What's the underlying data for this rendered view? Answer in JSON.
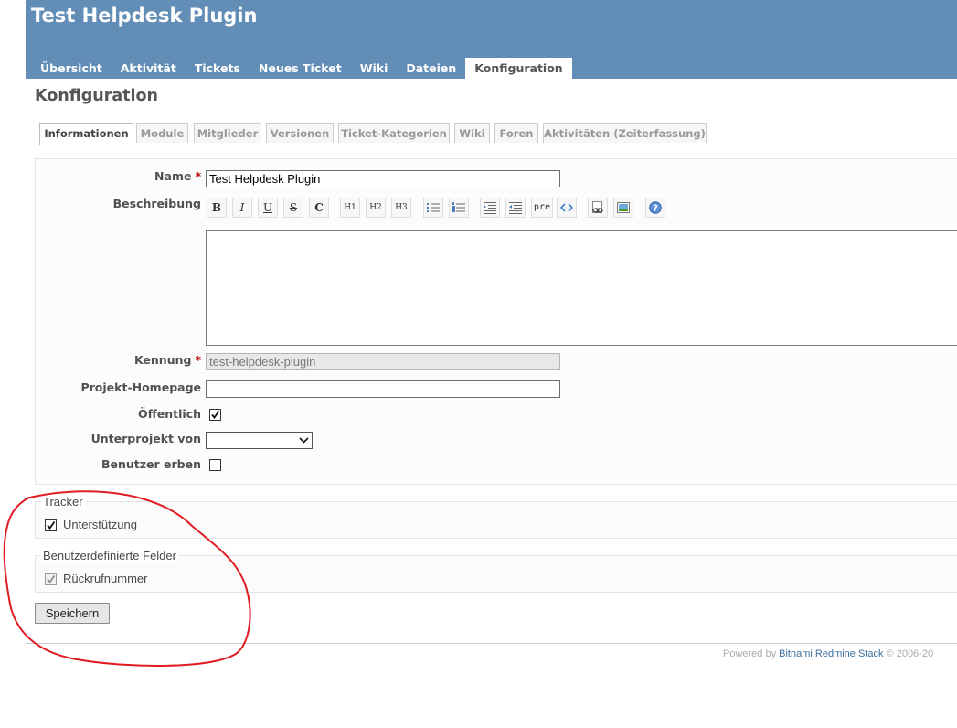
{
  "header": {
    "title": "Test Helpdesk Plugin",
    "menu": [
      {
        "label": "Übersicht"
      },
      {
        "label": "Aktivität"
      },
      {
        "label": "Tickets"
      },
      {
        "label": "Neues Ticket"
      },
      {
        "label": "Wiki"
      },
      {
        "label": "Dateien"
      },
      {
        "label": "Konfiguration",
        "selected": true
      }
    ]
  },
  "page_title": "Konfiguration",
  "tabs": [
    {
      "label": "Informationen",
      "selected": true
    },
    {
      "label": "Module"
    },
    {
      "label": "Mitglieder"
    },
    {
      "label": "Versionen"
    },
    {
      "label": "Ticket-Kategorien"
    },
    {
      "label": "Wiki"
    },
    {
      "label": "Foren"
    },
    {
      "label": "Aktivitäten (Zeiterfassung)"
    }
  ],
  "form": {
    "name_label": "Name",
    "required_mark": "*",
    "name_value": "Test Helpdesk Plugin",
    "description_label": "Beschreibung",
    "toolbar": [
      "B",
      "I",
      "U",
      "S",
      "C",
      "H1",
      "H2",
      "H3",
      "pre"
    ],
    "identifier_label": "Kennung",
    "identifier_value": "test-helpdesk-plugin",
    "homepage_label": "Projekt-Homepage",
    "homepage_value": "",
    "public_label": "Öffentlich",
    "public_checked": true,
    "parent_label": "Unterprojekt von",
    "parent_value": "",
    "inherit_label": "Benutzer erben",
    "inherit_checked": false
  },
  "trackers": {
    "legend": "Tracker",
    "items": [
      {
        "label": "Unterstützung",
        "checked": true
      }
    ]
  },
  "custom_fields": {
    "legend": "Benutzerdefinierte Felder",
    "items": [
      {
        "label": "Rückrufnummer",
        "checked": true,
        "disabled": true
      }
    ]
  },
  "save_label": "Speichern",
  "footer": {
    "prefix": "Powered by",
    "link": "Bitnami Redmine Stack",
    "suffix": "© 2006-20"
  },
  "colors": {
    "header_bg": "#628DB6",
    "annotation": "#E11B22"
  }
}
